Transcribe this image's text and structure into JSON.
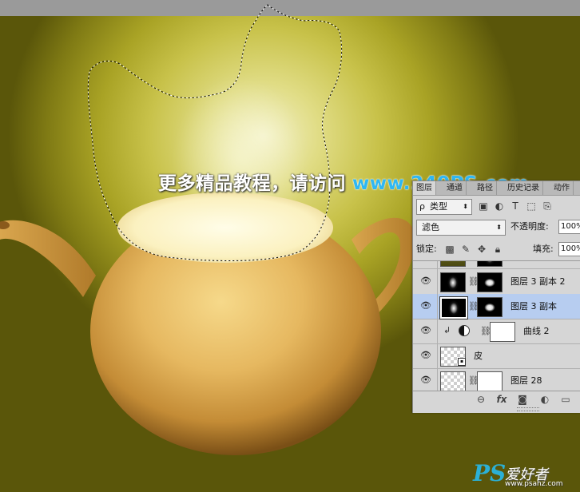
{
  "watermark": {
    "text_cn": "更多精品教程，请访问",
    "url": "www.240PS.com"
  },
  "layers_panel": {
    "tabs": [
      "图层",
      "通道",
      "路径",
      "历史记录",
      "动作"
    ],
    "active_tab": "图层",
    "kind_filter": "类型",
    "blend_mode": "滤色",
    "opacity_label": "不透明度:",
    "opacity_value": "100%",
    "lock_label": "锁定:",
    "fill_label": "填充:",
    "fill_value": "100%",
    "layers": [
      {
        "name": "图层 3 副本 2",
        "selected": false
      },
      {
        "name": "图层 3 副本",
        "selected": true
      },
      {
        "name": "曲线 2",
        "selected": false
      },
      {
        "name": "皮",
        "selected": false
      },
      {
        "name": "图层 28",
        "selected": false
      }
    ],
    "footer_icons": [
      "link-icon",
      "fx-icon",
      "mask-icon",
      "adjustment-icon",
      "folder-icon"
    ]
  },
  "brand": {
    "logo_ps": "PS",
    "logo_cn": "爱好者",
    "logo_url": "www.psahz.com"
  },
  "colors": {
    "url_blue": "#2fb7f3",
    "selection_blue": "#b7cdf0",
    "panel_bg": "#d6d6d6",
    "canvas_olive": "#a9a325"
  }
}
